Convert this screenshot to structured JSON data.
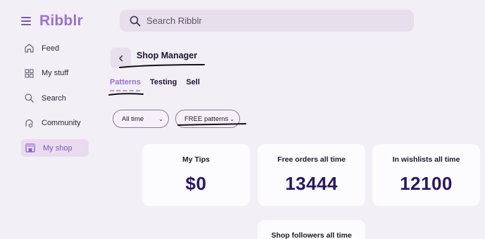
{
  "app": {
    "name": "Ribblr"
  },
  "search": {
    "placeholder": "Search Ribblr"
  },
  "nav": [
    {
      "label": "Feed",
      "icon": "home-icon"
    },
    {
      "label": "My stuff",
      "icon": "grid-icon"
    },
    {
      "label": "Search",
      "icon": "search-icon"
    },
    {
      "label": "Community",
      "icon": "community-icon"
    },
    {
      "label": "My shop",
      "icon": "shop-icon",
      "active": true
    }
  ],
  "page": {
    "title": "Shop Manager"
  },
  "tabs": [
    {
      "label": "Patterns",
      "active": true
    },
    {
      "label": "Testing"
    },
    {
      "label": "Sell"
    }
  ],
  "filters": {
    "time": {
      "value": "All time"
    },
    "type": {
      "value": "FREE patterns"
    }
  },
  "stats": [
    {
      "label": "My Tips",
      "value": "$0"
    },
    {
      "label": "Free orders all time",
      "value": "13444"
    },
    {
      "label": "In wishlists all time",
      "value": "12100"
    },
    {
      "label": "Shop followers all time",
      "value": ""
    }
  ],
  "colors": {
    "accent": "#9a73cc",
    "background": "#f3eff6",
    "card": "#fcfbfd"
  }
}
